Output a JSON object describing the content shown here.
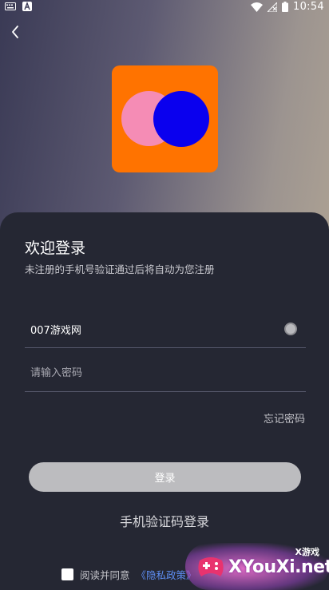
{
  "status_bar": {
    "time": "10:54",
    "left_icons": [
      "keyboard-icon",
      "android-a-icon"
    ],
    "right_icons": [
      "wifi-icon",
      "no-signal-icon",
      "battery-icon"
    ]
  },
  "header": {
    "back_icon": "chevron-left-icon"
  },
  "logo": {
    "colors": {
      "background": "#ff7300",
      "left_circle": "#f58cb5",
      "right_circle": "#0a00ee"
    }
  },
  "login": {
    "title": "欢迎登录",
    "subtitle": "未注册的手机号验证通过后将自动为您注册",
    "username_value": "007游戏网",
    "password_placeholder": "请输入密码",
    "forgot_password": "忘记密码",
    "login_button": "登录",
    "sms_login": "手机验证码登录",
    "agree_prefix": "阅读并同意",
    "privacy_link": "《隐私政策》"
  },
  "watermark": {
    "top_text": "X游戏",
    "main_text": "XYouXi.net"
  },
  "colors": {
    "sheet_bg": "#252733",
    "link": "#5d8cf0",
    "button_disabled": "#bcbcbf"
  }
}
